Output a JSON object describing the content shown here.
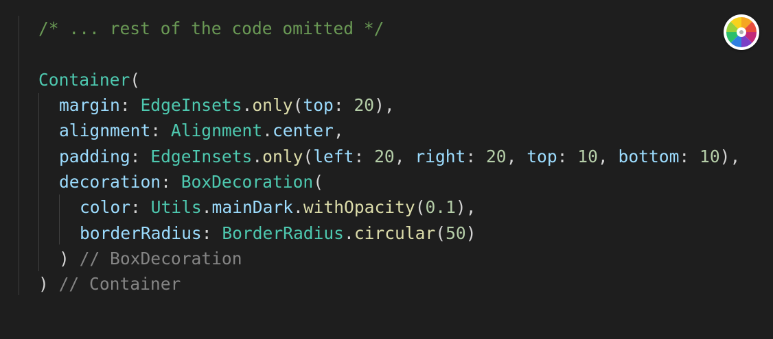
{
  "editor": {
    "lines": [
      [
        {
          "t": "/* ... rest of the code omitted */",
          "c": "comment"
        }
      ],
      [],
      [
        {
          "t": "Container",
          "c": "type"
        },
        {
          "t": "(",
          "c": "punc"
        }
      ],
      [
        {
          "t": "margin",
          "c": "prop"
        },
        {
          "t": ": ",
          "c": "punc"
        },
        {
          "t": "EdgeInsets",
          "c": "type"
        },
        {
          "t": ".",
          "c": "punc"
        },
        {
          "t": "only",
          "c": "func"
        },
        {
          "t": "(",
          "c": "punc"
        },
        {
          "t": "top",
          "c": "prop"
        },
        {
          "t": ": ",
          "c": "punc"
        },
        {
          "t": "20",
          "c": "num"
        },
        {
          "t": "),",
          "c": "punc"
        }
      ],
      [
        {
          "t": "alignment",
          "c": "prop"
        },
        {
          "t": ": ",
          "c": "punc"
        },
        {
          "t": "Alignment",
          "c": "type"
        },
        {
          "t": ".",
          "c": "punc"
        },
        {
          "t": "center",
          "c": "prop"
        },
        {
          "t": ",",
          "c": "punc"
        }
      ],
      [
        {
          "t": "padding",
          "c": "prop"
        },
        {
          "t": ": ",
          "c": "punc"
        },
        {
          "t": "EdgeInsets",
          "c": "type"
        },
        {
          "t": ".",
          "c": "punc"
        },
        {
          "t": "only",
          "c": "func"
        },
        {
          "t": "(",
          "c": "punc"
        },
        {
          "t": "left",
          "c": "prop"
        },
        {
          "t": ": ",
          "c": "punc"
        },
        {
          "t": "20",
          "c": "num"
        },
        {
          "t": ", ",
          "c": "punc"
        },
        {
          "t": "right",
          "c": "prop"
        },
        {
          "t": ": ",
          "c": "punc"
        },
        {
          "t": "20",
          "c": "num"
        },
        {
          "t": ", ",
          "c": "punc"
        },
        {
          "t": "top",
          "c": "prop"
        },
        {
          "t": ": ",
          "c": "punc"
        },
        {
          "t": "10",
          "c": "num"
        },
        {
          "t": ", ",
          "c": "punc"
        },
        {
          "t": "bottom",
          "c": "prop"
        },
        {
          "t": ": ",
          "c": "punc"
        },
        {
          "t": "10",
          "c": "num"
        },
        {
          "t": "),",
          "c": "punc"
        }
      ],
      [
        {
          "t": "decoration",
          "c": "prop"
        },
        {
          "t": ": ",
          "c": "punc"
        },
        {
          "t": "BoxDecoration",
          "c": "type"
        },
        {
          "t": "(",
          "c": "punc"
        }
      ],
      [
        {
          "t": "color",
          "c": "prop"
        },
        {
          "t": ": ",
          "c": "punc"
        },
        {
          "t": "Utils",
          "c": "type"
        },
        {
          "t": ".",
          "c": "punc"
        },
        {
          "t": "mainDark",
          "c": "prop"
        },
        {
          "t": ".",
          "c": "punc"
        },
        {
          "t": "withOpacity",
          "c": "func"
        },
        {
          "t": "(",
          "c": "punc"
        },
        {
          "t": "0.1",
          "c": "num"
        },
        {
          "t": "),",
          "c": "punc"
        }
      ],
      [
        {
          "t": "borderRadius",
          "c": "prop"
        },
        {
          "t": ": ",
          "c": "punc"
        },
        {
          "t": "BorderRadius",
          "c": "type"
        },
        {
          "t": ".",
          "c": "punc"
        },
        {
          "t": "circular",
          "c": "func"
        },
        {
          "t": "(",
          "c": "punc"
        },
        {
          "t": "50",
          "c": "num"
        },
        {
          "t": ")",
          "c": "punc"
        }
      ],
      [
        {
          "t": ") ",
          "c": "punc"
        },
        {
          "t": "// BoxDecoration",
          "c": "gray"
        }
      ],
      [
        {
          "t": ") ",
          "c": "punc"
        },
        {
          "t": "// Container",
          "c": "gray"
        }
      ]
    ]
  },
  "widget": {
    "icon": "color-wheel-icon",
    "colors": [
      "#f5a623",
      "#e94e3c",
      "#c2297a",
      "#7b3fc6",
      "#2f7fe0",
      "#2bbf6a",
      "#9bd13a",
      "#f8d21c"
    ]
  }
}
